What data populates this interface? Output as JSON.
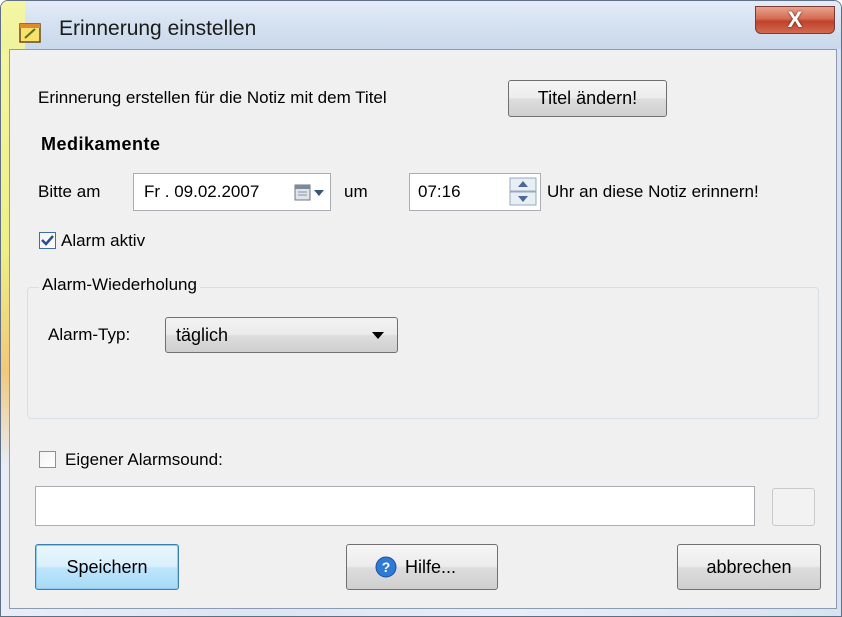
{
  "window": {
    "title": "Erinnerung einstellen",
    "close_label": "X"
  },
  "header": {
    "intro_text": "Erinnerung erstellen für die Notiz mit dem Titel",
    "change_title_button": "Titel ändern!",
    "note_title": "Medikamente"
  },
  "schedule": {
    "prefix": "Bitte am",
    "date_value": "Fr . 09.02.2007",
    "at_label": "um",
    "time_value": "07:16",
    "suffix": "Uhr an diese Notiz erinnern!"
  },
  "alarm": {
    "active_label": "Alarm aktiv",
    "active_checked": true,
    "repeat_group_title": "Alarm-Wiederholung",
    "type_label": "Alarm-Typ:",
    "type_value": "täglich"
  },
  "sound": {
    "custom_label": "Eigener Alarmsound:",
    "custom_checked": false,
    "path_value": ""
  },
  "footer": {
    "save_label": "Speichern",
    "help_label": "Hilfe...",
    "cancel_label": "abbrechen"
  },
  "colors": {
    "accent": "#3c7fb1",
    "close_red": "#c1412a",
    "client_bg": "#f0f0f0"
  },
  "icons": [
    "notepad-icon",
    "calendar-icon",
    "spin-arrows-icon",
    "help-icon",
    "dropdown-arrow-icon"
  ]
}
